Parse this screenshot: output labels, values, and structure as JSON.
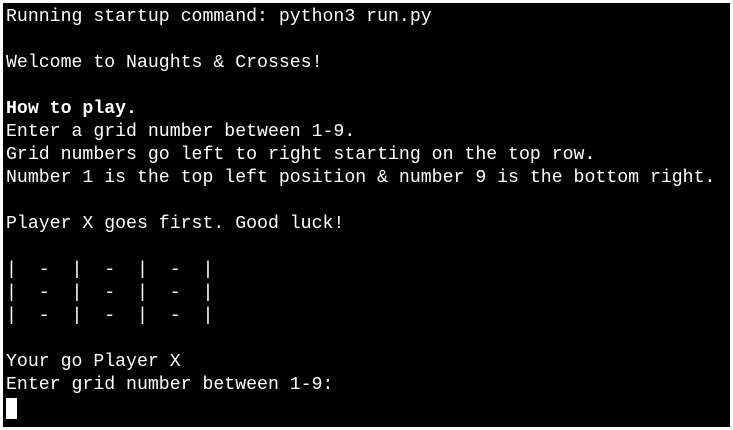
{
  "terminal": {
    "startup_line": "Running startup command: python3 run.py",
    "welcome_line": "Welcome to Naughts & Crosses!",
    "how_to_play_heading": "How to play.",
    "instruction_1": "Enter a grid number between 1-9.",
    "instruction_2": "Grid numbers go left to right starting on the top row.",
    "instruction_3": "Number 1 is the top left position & number 9 is the bottom right.",
    "first_player_line": "Player X goes first. Good luck!",
    "board": {
      "row_1": "|  -  |  -  |  -  |",
      "row_2": "|  -  |  -  |  -  |",
      "row_3": "|  -  |  -  |  -  |"
    },
    "turn_line": "Your go Player X",
    "input_prompt": "Enter grid number between 1-9:"
  }
}
